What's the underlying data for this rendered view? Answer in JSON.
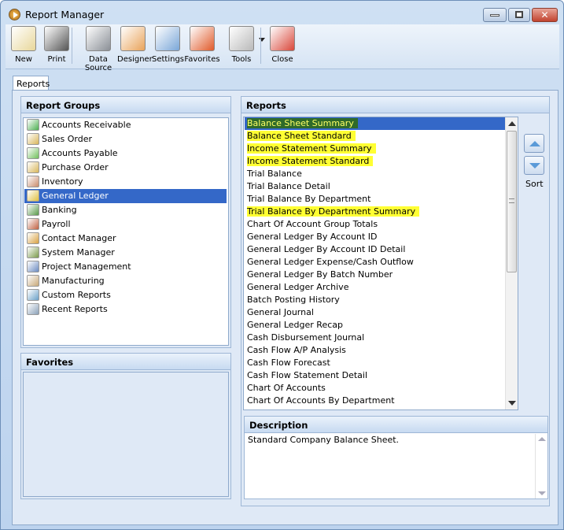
{
  "window": {
    "title": "Report Manager",
    "buttons": [
      "minimize",
      "maximize",
      "close"
    ]
  },
  "toolbar": [
    {
      "label": "New",
      "icon": "new-report-icon",
      "color": "#e8d79a"
    },
    {
      "label": "Print",
      "icon": "printer-icon",
      "color": "#555555"
    },
    {
      "label": "Data Source",
      "icon": "database-icon",
      "color": "#8a8f96"
    },
    {
      "label": "Designer",
      "icon": "designer-icon",
      "color": "#e9a35a"
    },
    {
      "label": "Settings",
      "icon": "settings-icon",
      "color": "#7aa6d8"
    },
    {
      "label": "Favorites",
      "icon": "favorites-icon",
      "color": "#e05a2a"
    },
    {
      "label": "Tools",
      "icon": "tools-icon",
      "color": "#b9b9b9"
    },
    {
      "label": "Close",
      "icon": "close-report-icon",
      "color": "#d9473a"
    }
  ],
  "tabs": [
    {
      "label": "Reports",
      "active": true
    }
  ],
  "report_groups": {
    "title": "Report Groups",
    "items": [
      {
        "label": "Accounts Receivable",
        "icon": "accounts-receivable-icon",
        "color": "#4caf50"
      },
      {
        "label": "Sales Order",
        "icon": "sales-order-icon",
        "color": "#d8b65a"
      },
      {
        "label": "Accounts Payable",
        "icon": "accounts-payable-icon",
        "color": "#6fbf5a"
      },
      {
        "label": "Purchase Order",
        "icon": "purchase-order-icon",
        "color": "#d8b65a"
      },
      {
        "label": "Inventory",
        "icon": "inventory-icon",
        "color": "#c98a6a"
      },
      {
        "label": "General Ledger",
        "icon": "general-ledger-icon",
        "color": "#e0c040",
        "selected": true
      },
      {
        "label": "Banking",
        "icon": "banking-icon",
        "color": "#5a9a4a"
      },
      {
        "label": "Payroll",
        "icon": "payroll-icon",
        "color": "#c06040"
      },
      {
        "label": "Contact Manager",
        "icon": "contact-manager-icon",
        "color": "#d8a040"
      },
      {
        "label": "System Manager",
        "icon": "system-manager-icon",
        "color": "#7a9a4a"
      },
      {
        "label": "Project Management",
        "icon": "project-management-icon",
        "color": "#6a8ac0"
      },
      {
        "label": "Manufacturing",
        "icon": "manufacturing-icon",
        "color": "#c8a878"
      },
      {
        "label": "Custom Reports",
        "icon": "custom-reports-icon",
        "color": "#6aa0c8"
      },
      {
        "label": "Recent Reports",
        "icon": "recent-reports-icon",
        "color": "#8aa0b8"
      }
    ]
  },
  "favorites": {
    "title": "Favorites",
    "items": []
  },
  "reports": {
    "title": "Reports",
    "items": [
      {
        "label": "Balance Sheet Summary",
        "highlighted": true,
        "selected": true
      },
      {
        "label": "Balance Sheet Standard",
        "highlighted": true
      },
      {
        "label": "Income Statement Summary",
        "highlighted": true
      },
      {
        "label": "Income Statement Standard",
        "highlighted": true
      },
      {
        "label": "Trial Balance"
      },
      {
        "label": "Trial Balance Detail"
      },
      {
        "label": "Trial Balance By Department"
      },
      {
        "label": "Trial Balance By Department Summary",
        "highlighted": true
      },
      {
        "label": "Chart Of Account Group Totals"
      },
      {
        "label": "General Ledger By Account ID"
      },
      {
        "label": "General Ledger By Account ID Detail"
      },
      {
        "label": "General Ledger Expense/Cash Outflow"
      },
      {
        "label": "General Ledger By Batch Number"
      },
      {
        "label": "General Ledger Archive"
      },
      {
        "label": "Batch Posting History"
      },
      {
        "label": "General Journal"
      },
      {
        "label": "General Ledger Recap"
      },
      {
        "label": "Cash Disbursement Journal"
      },
      {
        "label": "Cash Flow A/P Analysis"
      },
      {
        "label": "Cash Flow Forecast"
      },
      {
        "label": "Cash Flow Statement Detail"
      },
      {
        "label": "Chart Of Accounts"
      },
      {
        "label": "Chart Of Accounts By Department"
      }
    ],
    "highlight_color": "#ffff33",
    "selection_color": "#3468c8"
  },
  "sort": {
    "label": "Sort"
  },
  "description": {
    "title": "Description",
    "text": "Standard Company Balance Sheet."
  }
}
